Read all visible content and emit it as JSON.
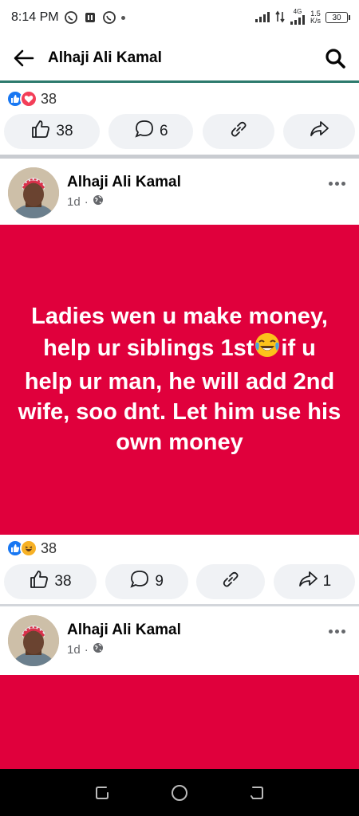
{
  "status_bar": {
    "time": "8:14 PM",
    "network": "4G",
    "speed_value": "1.5",
    "speed_unit": "K/s",
    "battery": "30"
  },
  "header": {
    "title": "Alhaji Ali Kamal"
  },
  "post1_footer": {
    "reaction_count": "38",
    "reaction_icons": [
      "like-icon",
      "love-icon"
    ],
    "like_count": "38",
    "comment_count": "6",
    "share_count": ""
  },
  "post2": {
    "author": "Alhaji Ali Kamal",
    "time": "1d",
    "separator": "·",
    "text_lines": [
      "Ladies wen u make money,",
      "help ur siblings 1st",
      "if u",
      "help ur man, he will add 2nd",
      "wife, soo dnt. Let him use his",
      "own money"
    ],
    "background_color": "#e0003c",
    "reaction_count": "38",
    "reaction_icons": [
      "like-icon",
      "haha-icon"
    ],
    "like_count": "38",
    "comment_count": "9",
    "share_count": "1"
  },
  "post3": {
    "author": "Alhaji Ali Kamal",
    "time": "1d",
    "separator": "·",
    "background_color": "#e0003c"
  },
  "colors": {
    "accent": "#1877f2",
    "header_underline": "#2d7a6d",
    "pill_bg": "#f0f2f5"
  }
}
